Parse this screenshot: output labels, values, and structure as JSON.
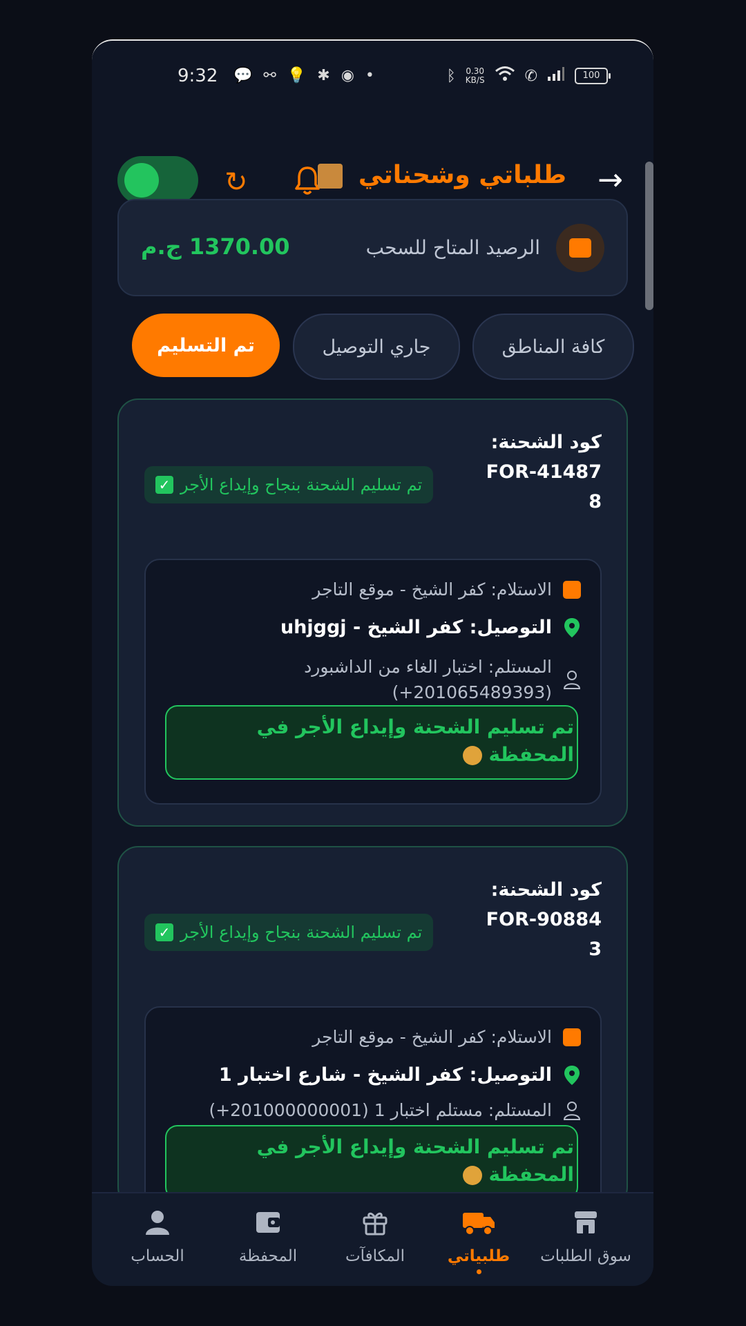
{
  "status_bar": {
    "time": "9:32",
    "speed_value": "0.30",
    "speed_unit": "KB/S",
    "battery": "100"
  },
  "header": {
    "title": "طلباتي وشحناتي",
    "online_toggle": true
  },
  "balance": {
    "label": "الرصيد المتاح للسحب",
    "amount": "1370.00 ج.م"
  },
  "tabs": [
    {
      "label": "كافة المناطق",
      "active": false
    },
    {
      "label": "جاري التوصيل",
      "active": false
    },
    {
      "label": "تم التسليم",
      "active": true
    }
  ],
  "orders": [
    {
      "code_label": "كود الشحنة:",
      "code": "FOR-414878",
      "status": "تم تسليم الشحنة بنجاح وإيداع الأجر",
      "pickup": "الاستلام: كفر الشيخ - موقع التاجر",
      "delivery": "التوصيل: كفر الشيخ - uhjggj",
      "recipient": "المستلم: اختبار الغاء من الداشبورد (201065489393+)",
      "note": "تم تسليم الشحنة وإيداع الأجر في المحفظة"
    },
    {
      "code_label": "كود الشحنة:",
      "code": "FOR-908843",
      "status": "تم تسليم الشحنة بنجاح وإيداع الأجر",
      "pickup": "الاستلام: كفر الشيخ - موقع التاجر",
      "delivery": "التوصيل: كفر الشيخ - شارع اختبار 1",
      "recipient": "المستلم: مستلم اختبار 1 (201000000001+)",
      "note": "تم تسليم الشحنة وإيداع الأجر في المحفظة"
    }
  ],
  "bottom_nav": [
    {
      "label": "سوق الطلبات",
      "icon": "store-icon",
      "active": false
    },
    {
      "label": "طلبياتي",
      "icon": "truck-icon",
      "active": true
    },
    {
      "label": "المكافآت",
      "icon": "gift-icon",
      "active": false
    },
    {
      "label": "المحفظة",
      "icon": "wallet-icon",
      "active": false
    },
    {
      "label": "الحساب",
      "icon": "user-icon",
      "active": false
    }
  ],
  "colors": {
    "accent": "#ff7a00",
    "success": "#22c55e",
    "background": "#0f1524",
    "card": "#172033"
  }
}
